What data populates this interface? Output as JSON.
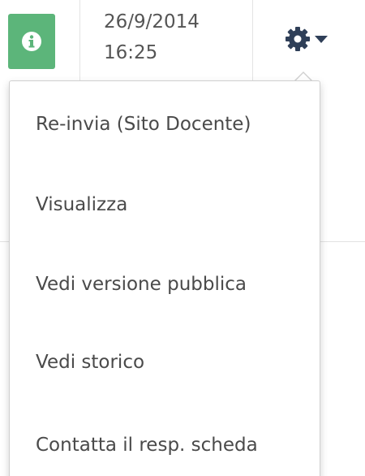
{
  "row": {
    "info_icon": "info-circle-icon",
    "info_badge_color": "#5cb57a",
    "date": "26/9/2014",
    "time": "16:25",
    "settings_icon": "gear-icon",
    "dropdown_icon": "caret-down-icon"
  },
  "menu": {
    "items": [
      {
        "label": "Re-invia (Sito Docente)"
      },
      {
        "label": "Visualizza"
      },
      {
        "label": "Vedi versione pubblica"
      },
      {
        "label": "Vedi storico"
      },
      {
        "label": "Contatta il resp. scheda"
      }
    ]
  },
  "colors": {
    "text": "#4a4a4a",
    "gear": "#2f3f58",
    "border": "#d0d0d0"
  }
}
